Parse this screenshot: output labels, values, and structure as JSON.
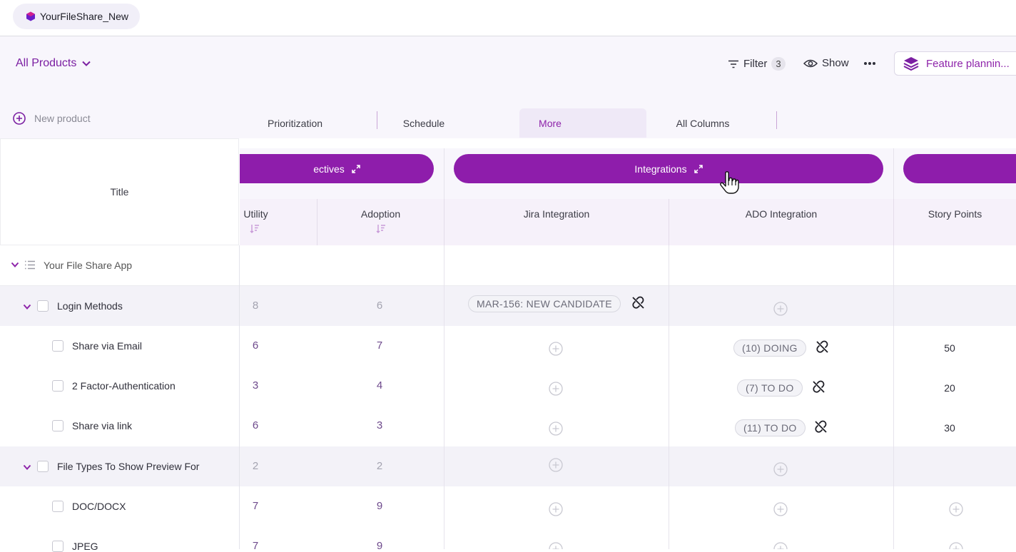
{
  "workspace": {
    "name": "YourFileShare_New"
  },
  "toolbar": {
    "product_selector": "All Products",
    "filter_label": "Filter",
    "filter_count": "3",
    "show_label": "Show",
    "more_icon": "ellipsis-icon",
    "view_label": "Feature plannin..."
  },
  "new_product_label": "New product",
  "tabs": [
    {
      "label": "Prioritization",
      "active": false
    },
    {
      "label": "Schedule",
      "active": false
    },
    {
      "label": "More",
      "active": true
    },
    {
      "label": "All Columns",
      "active": false
    }
  ],
  "grid": {
    "title_header": "Title",
    "groups": [
      {
        "label": "ectives"
      },
      {
        "label": "Integrations"
      }
    ],
    "columns": [
      "Utility",
      "Adoption",
      "Jira Integration",
      "ADO Integration",
      "Story Points"
    ],
    "root": {
      "label": "Your File Share App"
    },
    "rows": [
      {
        "label": "Login Methods",
        "utility": "8",
        "adoption": "6",
        "jira": "MAR-156: NEW CANDIDATE",
        "ado": "",
        "story_points": ""
      },
      {
        "label": "Share via Email",
        "utility": "6",
        "adoption": "7",
        "jira": "",
        "ado": "(10) DOING",
        "story_points": "50"
      },
      {
        "label": "2 Factor-Authentication",
        "utility": "3",
        "adoption": "4",
        "jira": "",
        "ado": "(7) TO DO",
        "story_points": "20"
      },
      {
        "label": "Share via link",
        "utility": "6",
        "adoption": "3",
        "jira": "",
        "ado": "(11) TO DO",
        "story_points": "30"
      },
      {
        "label": "File Types To Show Preview For",
        "utility": "2",
        "adoption": "2",
        "jira": "",
        "ado": "",
        "story_points": ""
      },
      {
        "label": "DOC/DOCX",
        "utility": "7",
        "adoption": "9",
        "jira": "",
        "ado": "",
        "story_points": ""
      },
      {
        "label": "JPEG",
        "utility": "7",
        "adoption": "9",
        "jira": "",
        "ado": "",
        "story_points": ""
      }
    ]
  },
  "colors": {
    "accent": "#8e1dab",
    "accent_text": "#7b1fa2",
    "row_shade": "#f3f2f8",
    "header_bg": "#f8f6fc"
  }
}
